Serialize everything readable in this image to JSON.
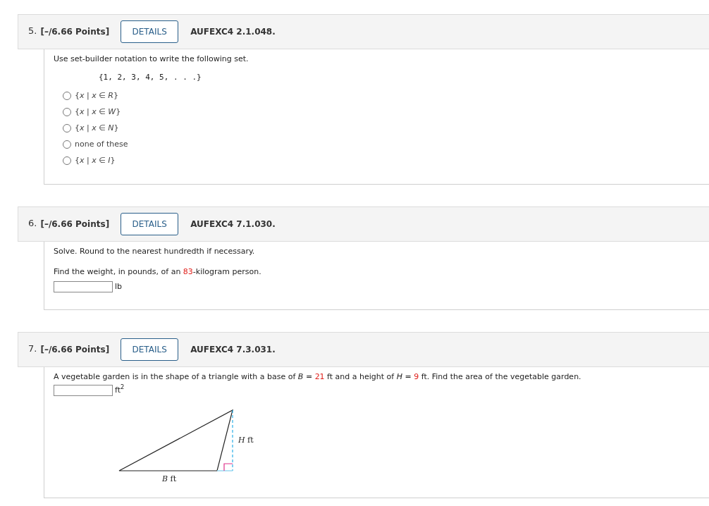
{
  "questions": [
    {
      "number": "5.",
      "points": "[–/6.66 Points]",
      "details": "DETAILS",
      "code": "AUFEXC4 2.1.048.",
      "kind": "choice",
      "prompt": [
        [
          {
            "kind": "text",
            "text": "Use set-builder notation to write the following set."
          }
        ]
      ],
      "set": "{1, 2, 3, 4, 5, . . .}",
      "options": [
        {
          "label": "{*x* | *x* ∈ *R*}",
          "selected": false
        },
        {
          "label": "{*x* | *x* ∈ *W*}",
          "selected": false
        },
        {
          "label": "{*x* | *x* ∈ *N*}",
          "selected": false
        },
        {
          "label": "none of these",
          "selected": false
        },
        {
          "label": "{*x* | *x* ∈ *I*}",
          "selected": false
        }
      ]
    },
    {
      "number": "6.",
      "points": "[–/6.66 Points]",
      "details": "DETAILS",
      "code": "AUFEXC4 7.1.030.",
      "kind": "answer",
      "prompt": [
        [
          {
            "kind": "text",
            "text": "Solve. Round to the nearest hundredth if necessary."
          }
        ],
        [
          {
            "kind": "text",
            "text": "Find the weight, in pounds, of an "
          },
          {
            "kind": "given",
            "text": "83"
          },
          {
            "kind": "text",
            "text": "-kilogram person."
          }
        ]
      ],
      "unit": "lb"
    },
    {
      "number": "7.",
      "points": "[–/6.66 Points]",
      "details": "DETAILS",
      "code": "AUFEXC4 7.3.031.",
      "kind": "answer",
      "prompt": [
        [
          {
            "kind": "text",
            "text": "A vegetable garden is in the shape of a triangle with a base of *B* = "
          },
          {
            "kind": "given",
            "text": "21"
          },
          {
            "kind": "text",
            "text": " ft and a height of *H* = "
          },
          {
            "kind": "given",
            "text": "9"
          },
          {
            "kind": "text",
            "text": " ft. Find the area of the vegetable garden."
          }
        ]
      ],
      "unit": "ft$^{2}$",
      "figure": {
        "height_label": "*H* ft",
        "base_label": "*B* ft"
      }
    }
  ]
}
